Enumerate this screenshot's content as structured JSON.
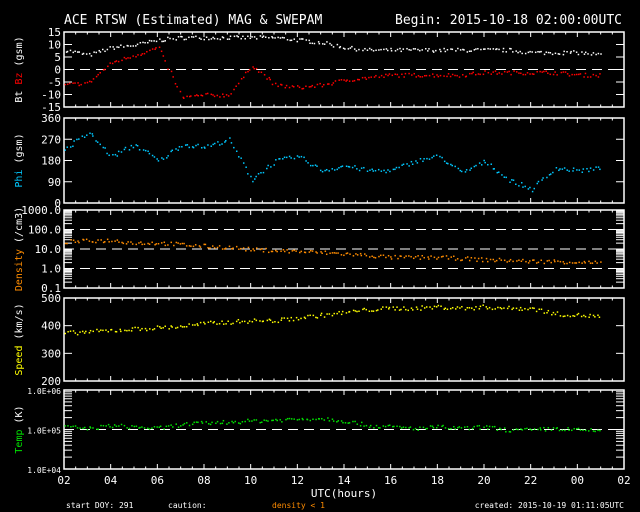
{
  "chart_data": {
    "type": "scatter",
    "title": "ACE RTSW (Estimated) MAG & SWEPAM",
    "begin": "Begin: 2015-10-18 02:00:00UTC",
    "xlabel": "UTC(hours)",
    "x_ticks": [
      "02",
      "04",
      "06",
      "08",
      "10",
      "12",
      "14",
      "16",
      "18",
      "20",
      "22",
      "00",
      "02"
    ],
    "x_hours": [
      2,
      3,
      4,
      5,
      6,
      7,
      8,
      9,
      10,
      11,
      12,
      13,
      14,
      15,
      16,
      17,
      18,
      19,
      20,
      21,
      22,
      23,
      24,
      25
    ],
    "footer": {
      "start_doy": "start DOY: 291",
      "caution": "caution:",
      "caution_note": "density < 1",
      "created": "created: 2015-10-19 01:11:05UTC"
    },
    "colors": {
      "bt": "#ffffff",
      "bz": "#ff0000",
      "phi": "#00c8ff",
      "density": "#ff8c00",
      "speed": "#ffff00",
      "temp": "#00e000",
      "axes": "#ffffff"
    },
    "panels": [
      {
        "id": "mag",
        "ylabel_parts": [
          "Bt",
          "Bz",
          "(gsm)"
        ],
        "scale": "linear",
        "ylim": [
          -15,
          15
        ],
        "y_ticks": [
          "15",
          "10",
          "5",
          "0",
          "-5",
          "-10",
          "-15"
        ],
        "y_tick_values": [
          15,
          10,
          5,
          0,
          -5,
          -10,
          -15
        ],
        "ref_lines": [
          0
        ],
        "series": [
          {
            "name": "Bt",
            "color_key": "bt",
            "values": [
              8,
              6,
              9,
              10,
              12,
              13,
              13,
              13,
              13,
              13,
              12,
              11,
              9,
              8,
              8,
              8,
              8,
              8,
              8,
              8,
              7,
              7,
              7,
              6
            ]
          },
          {
            "name": "Bz",
            "color_key": "bz",
            "values": [
              -6,
              -5,
              3,
              6,
              9,
              -11,
              -10,
              -10,
              2,
              -6,
              -7,
              -6,
              -4,
              -3,
              -2,
              -2,
              -2,
              -2,
              -1,
              -1,
              -1,
              -1,
              -2,
              -2
            ]
          }
        ]
      },
      {
        "id": "phi",
        "ylabel_parts": [
          "Phi",
          "(gsm)"
        ],
        "scale": "linear",
        "ylim": [
          0,
          360
        ],
        "y_ticks": [
          "360",
          "270",
          "180",
          "90",
          "0"
        ],
        "y_tick_values": [
          360,
          270,
          180,
          90,
          0
        ],
        "ref_lines": [],
        "series": [
          {
            "name": "Phi",
            "color_key": "phi",
            "values": [
              230,
              300,
              200,
              250,
              180,
              250,
              240,
              270,
              100,
              180,
              200,
              140,
              160,
              140,
              140,
              180,
              200,
              130,
              180,
              100,
              60,
              150,
              140,
              150
            ]
          }
        ]
      },
      {
        "id": "density",
        "ylabel_parts": [
          "Density",
          "(/cm3)"
        ],
        "scale": "log",
        "ylim": [
          0.1,
          1000
        ],
        "y_ticks": [
          "1000.0",
          "100.0",
          "10.0",
          "1.0",
          "0.1"
        ],
        "y_tick_values": [
          1000,
          100,
          10,
          1,
          0.1
        ],
        "ref_lines": [
          100,
          10,
          1
        ],
        "series": [
          {
            "name": "Density",
            "color_key": "density",
            "values": [
              25,
              28,
              30,
              22,
              22,
              18,
              15,
              13,
              10,
              9,
              8,
              7,
              6,
              5,
              4,
              4,
              4,
              3.5,
              3,
              2.8,
              2.5,
              2.5,
              2.3,
              2
            ]
          }
        ]
      },
      {
        "id": "speed",
        "ylabel_parts": [
          "Speed",
          "(km/s)"
        ],
        "scale": "linear",
        "ylim": [
          200,
          500
        ],
        "y_ticks": [
          "500",
          "400",
          "300",
          "200"
        ],
        "y_tick_values": [
          500,
          400,
          300,
          200
        ],
        "ref_lines": [],
        "series": [
          {
            "name": "Speed",
            "color_key": "speed",
            "values": [
              375,
              380,
              385,
              390,
              395,
              400,
              410,
              415,
              420,
              420,
              430,
              440,
              450,
              460,
              465,
              465,
              470,
              465,
              470,
              465,
              465,
              445,
              440,
              435
            ]
          }
        ]
      },
      {
        "id": "temp",
        "ylabel_parts": [
          "Temp",
          "(K)"
        ],
        "scale": "log",
        "ylim": [
          10000,
          1000000
        ],
        "y_ticks": [
          "1.0E+06",
          "1.0E+05",
          "1.0E+04"
        ],
        "y_tick_values": [
          1000000,
          100000,
          10000
        ],
        "ref_lines": [
          100000
        ],
        "series": [
          {
            "name": "Temp",
            "color_key": "temp",
            "values": [
              120000,
              110000,
              130000,
              120000,
              110000,
              140000,
              150000,
              160000,
              170000,
              180000,
              190000,
              200000,
              170000,
              130000,
              120000,
              110000,
              120000,
              110000,
              120000,
              100000,
              100000,
              110000,
              100000,
              95000
            ]
          }
        ]
      }
    ]
  }
}
